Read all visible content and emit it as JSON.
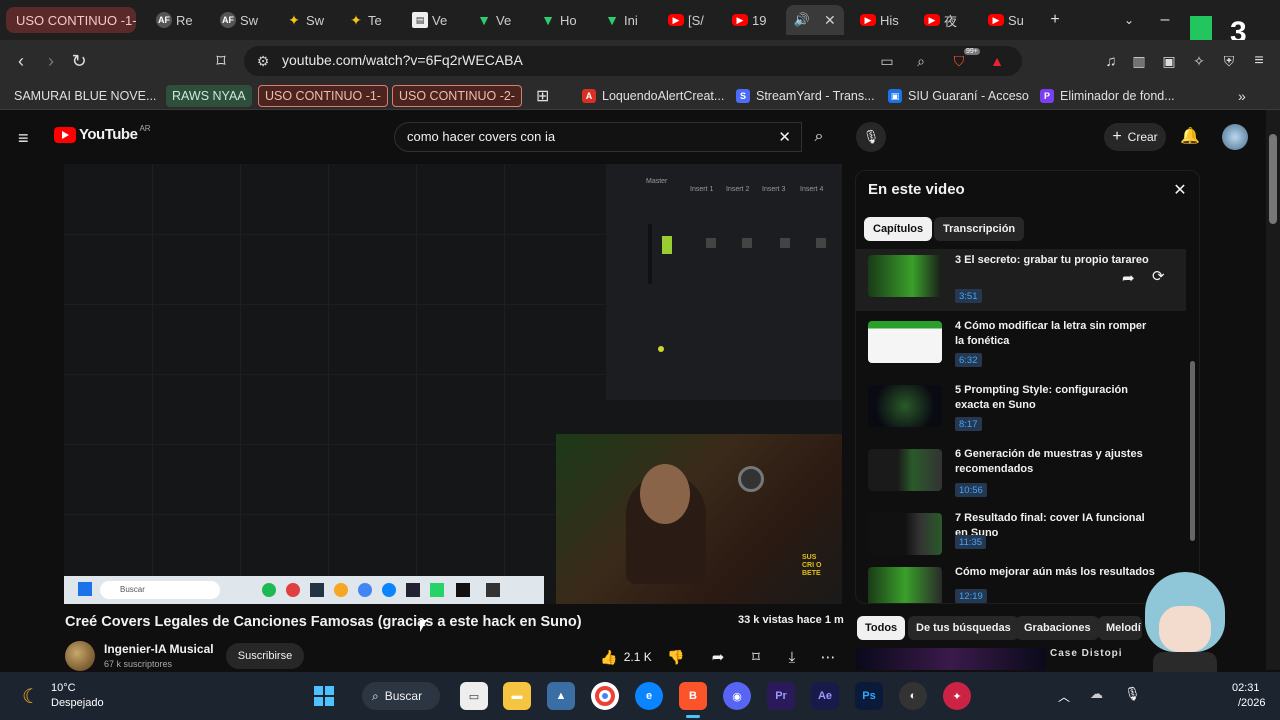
{
  "browser": {
    "tabs": [
      {
        "label": "USO CONTINUO -1-",
        "kind": "group"
      },
      {
        "label": "Re",
        "icon": "AF"
      },
      {
        "label": "Sw",
        "icon": "AF"
      },
      {
        "label": "Sw",
        "icon": "star"
      },
      {
        "label": "Te",
        "icon": "star"
      },
      {
        "label": "Ve",
        "icon": "doc"
      },
      {
        "label": "Ve",
        "icon": "v"
      },
      {
        "label": "Ho",
        "icon": "v"
      },
      {
        "label": "Ini",
        "icon": "v"
      },
      {
        "label": "[S/",
        "icon": "yt"
      },
      {
        "label": "19",
        "icon": "yt"
      },
      {
        "label": "",
        "icon": "speaker",
        "active": true
      },
      {
        "label": "His",
        "icon": "yt"
      },
      {
        "label": "夜",
        "icon": "yt"
      },
      {
        "label": "Su",
        "icon": "yt"
      }
    ],
    "url": "youtube.com/watch?v=6Fq2rWECABA",
    "extension_badge": "99+",
    "overlay_logo": "3",
    "bookmarks": [
      {
        "label": "SAMURAI BLUE NOVE...",
        "style": "plain"
      },
      {
        "label": "RAWS NYAA",
        "style": "green"
      },
      {
        "label": "USO CONTINUO -1-",
        "style": "red"
      },
      {
        "label": "USO CONTINUO -2-",
        "style": "red"
      },
      {
        "label": "LoquendoAlertCreat...",
        "style": "fav",
        "color": "#d93025"
      },
      {
        "label": "StreamYard - Trans...",
        "style": "fav",
        "color": "#4a6cf7"
      },
      {
        "label": "SIU Guaraní - Acceso",
        "style": "fav",
        "color": "#1a73e8"
      },
      {
        "label": "Eliminador de fond...",
        "style": "fav",
        "color": "#7b3ff2"
      }
    ]
  },
  "youtube": {
    "logo_text": "YouTube",
    "region": "AR",
    "search_query": "como hacer covers con ia",
    "create_label": "Crear",
    "video": {
      "title": "Creé Covers Legales de Canciones Famosas (gracias a este hack en Suno)",
      "views": "33 k vistas  hace 1 m",
      "channel": "Ingenier-IA Musical",
      "subscribers": "67 k suscriptores",
      "subscribe_label": "Suscribirse",
      "likes": "2.1 K"
    },
    "player": {
      "mixer_labels": [
        "Master",
        "Insert 1",
        "Insert 2",
        "Insert 3",
        "Insert 4"
      ],
      "inner_taskbar_search": "Buscar"
    },
    "chapters_panel": {
      "title": "En este video",
      "tabs": [
        "Capítulos",
        "Transcripción"
      ],
      "items": [
        {
          "title": "3 El secreto: grabar tu propio tarareo",
          "time": "3:51",
          "thumb": "green"
        },
        {
          "title": "4 Cómo modificar la letra sin romper la fonética",
          "time": "6:32",
          "thumb": "white"
        },
        {
          "title": "5 Prompting Style: configuración exacta en Suno",
          "time": "8:17",
          "thumb": "dark"
        },
        {
          "title": "6 Generación de muestras y ajustes recomendados",
          "time": "10:56",
          "thumb": "mixed"
        },
        {
          "title": "7 Resultado final: cover IA funcional en Suno",
          "time": "11:35",
          "thumb": "mixed"
        },
        {
          "title": "Cómo mejorar aún más los resultados",
          "time": "12:19",
          "thumb": "green"
        }
      ]
    },
    "filter_chips": [
      "Todos",
      "De tus búsquedas",
      "Grabaciones",
      "Melodí"
    ],
    "next_video_label": "Case Distopi"
  },
  "taskbar": {
    "weather_temp": "10°C",
    "weather_desc": "Despejado",
    "search_label": "Buscar",
    "time": "02:31",
    "date": "/2026"
  },
  "colors": {
    "accent_red": "#ff0000",
    "link_blue": "#3ea6ff",
    "bg": "#0f0f0f"
  }
}
